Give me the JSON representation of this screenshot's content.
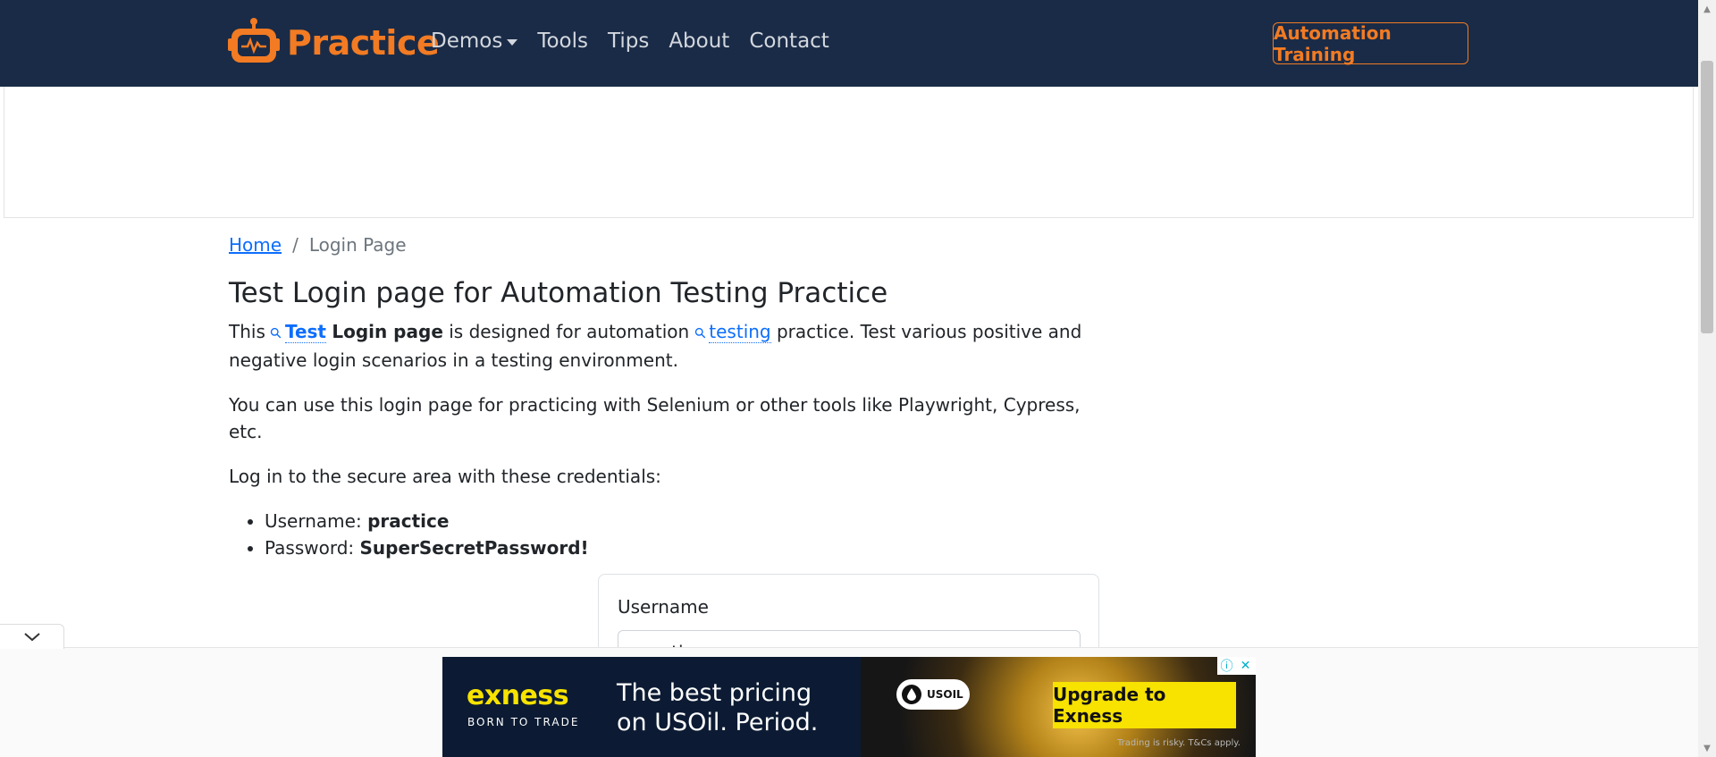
{
  "navbar": {
    "brand": "Practice",
    "items": [
      {
        "label": "Demos",
        "has_caret": true
      },
      {
        "label": "Tools"
      },
      {
        "label": "Tips"
      },
      {
        "label": "About"
      },
      {
        "label": "Contact"
      }
    ],
    "cta_label": "Automation Training",
    "colors": {
      "background": "#1a2b47",
      "accent": "#f27b23"
    }
  },
  "breadcrumb": {
    "home": "Home",
    "separator": "/",
    "current": "Login Page"
  },
  "page": {
    "title": "Test Login page for Automation Testing Practice",
    "intro": {
      "t1": "This ",
      "kw1": "Test",
      "bold1": "Login page",
      "t2": " is designed for automation ",
      "kw2": "testing",
      "t3": " practice. Test various positive and negative login scenarios in a testing environment."
    },
    "p2": "You can use this login page for practicing with Selenium or other tools like Playwright, Cypress, etc.",
    "p3": "Log in to the secure area with these credentials:",
    "credentials": {
      "username_label": "Username: ",
      "username_value": "practice",
      "password_label": "Password: ",
      "password_value": "SuperSecretPassword!"
    }
  },
  "login_form": {
    "username_label": "Username",
    "username_value": "practice"
  },
  "ad_banner": {
    "logo": "exness",
    "tagline": "BORN TO TRADE",
    "headline_line1": "The best pricing",
    "headline_line2": "on USOil. Period.",
    "pill": "USOIL",
    "button": "Upgrade to Exness",
    "disclaimer": "Trading is risky. T&Cs apply.",
    "info_icon": "ⓘ",
    "close_icon": "✕"
  }
}
